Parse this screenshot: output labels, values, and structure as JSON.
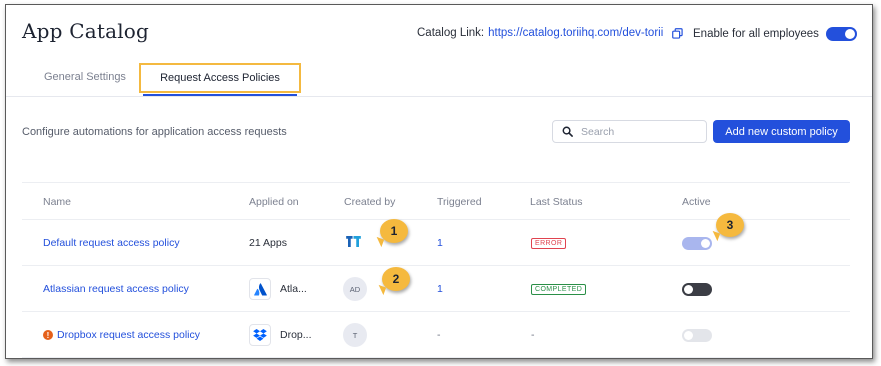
{
  "header": {
    "title": "App Catalog",
    "catalog_link_label": "Catalog Link:",
    "catalog_link_url": "https://catalog.toriihq.com/dev-torii",
    "enable_label": "Enable for all employees"
  },
  "tabs": [
    {
      "label": "General Settings",
      "active": false
    },
    {
      "label": "Request Access Policies",
      "active": true
    }
  ],
  "toolbar": {
    "description": "Configure automations for application access requests",
    "search_placeholder": "Search",
    "add_button_label": "Add new custom policy"
  },
  "table": {
    "columns": [
      "Name",
      "Applied on",
      "Created by",
      "Triggered",
      "Last Status",
      "Active"
    ],
    "rows": [
      {
        "name": "Default request access policy",
        "applied_on": "21 Apps",
        "created_by": "",
        "triggered": "1",
        "last_status": "ERROR",
        "active": "on"
      },
      {
        "name": "Atlassian request access policy",
        "applied_on": "Atla...",
        "created_by": "AD",
        "triggered": "1",
        "last_status": "COMPLETED",
        "active": "off"
      },
      {
        "name": "Dropbox request access policy",
        "applied_on": "Drop...",
        "created_by": "T",
        "triggered": "-",
        "last_status": "-",
        "active": "off-disabled"
      }
    ]
  },
  "callouts": [
    "1",
    "2",
    "3"
  ],
  "colors": {
    "accent": "#2350dc",
    "highlight": "#f4b940",
    "error": "#e0434f",
    "success": "#2a8f47",
    "warning": "#e5611b"
  },
  "icons": [
    "copy-icon",
    "search-icon",
    "torii-logo-icon",
    "atlassian-logo-icon",
    "dropbox-logo-icon",
    "warning-icon"
  ]
}
